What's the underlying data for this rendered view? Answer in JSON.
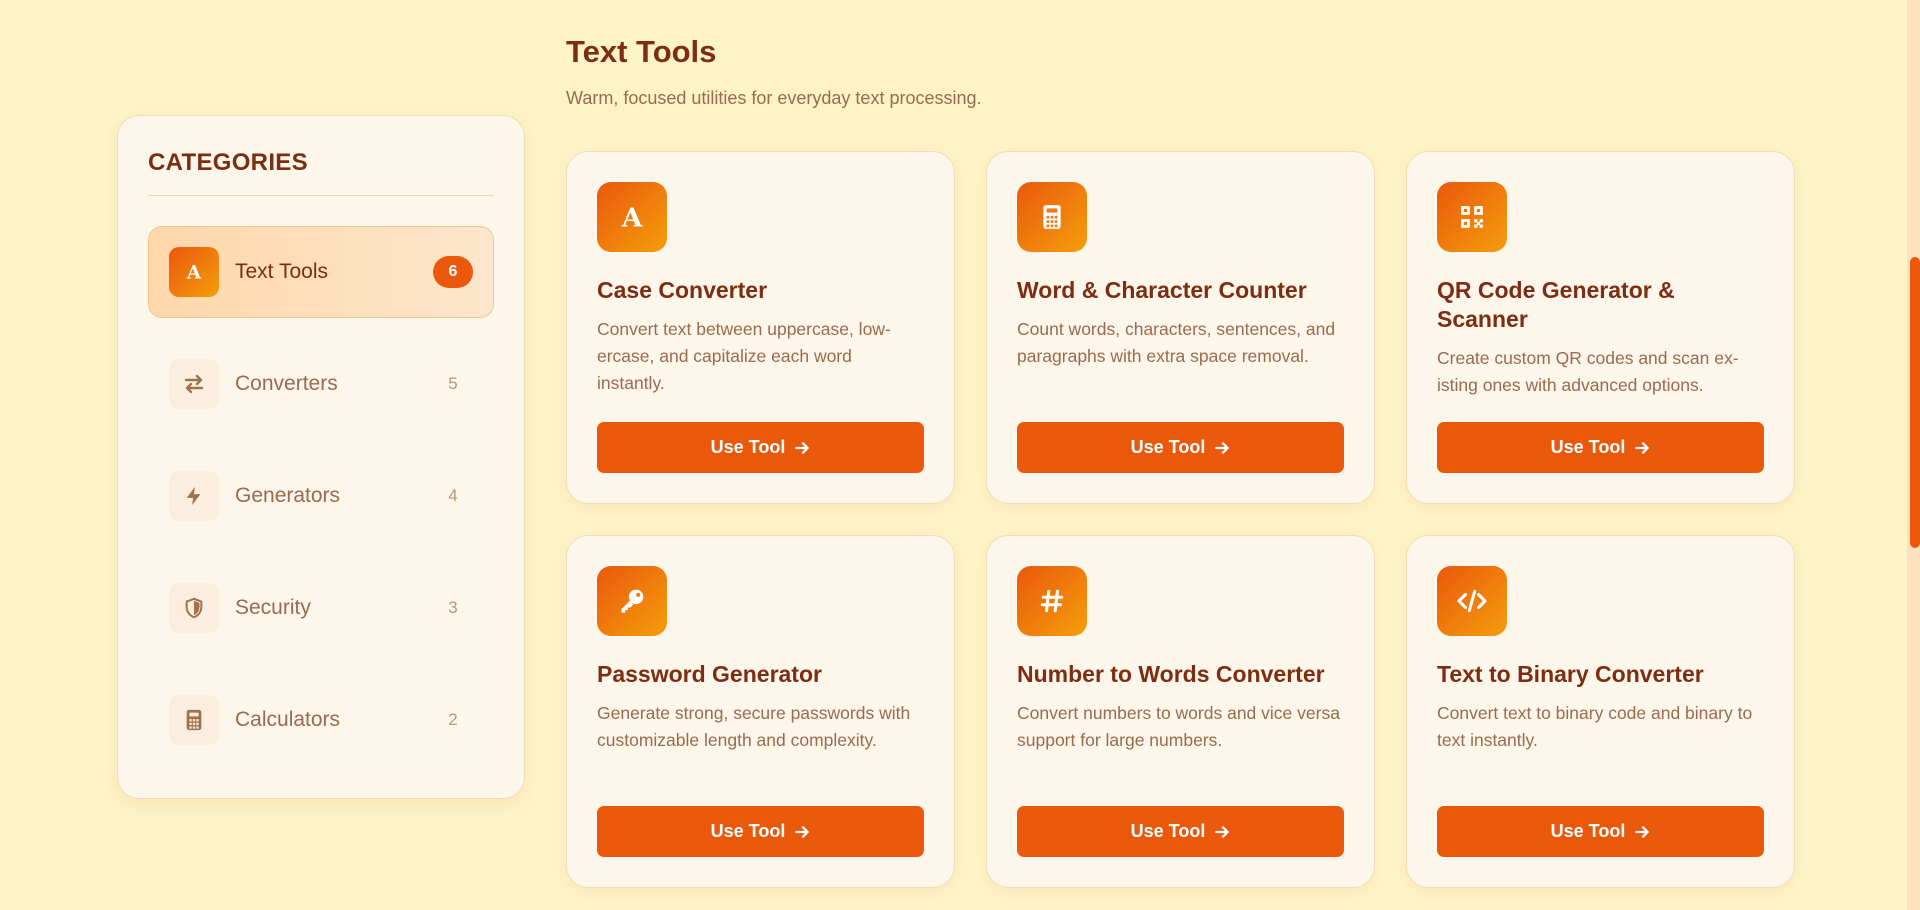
{
  "header": {
    "title": "Text Tools",
    "subtitle": "Warm, focused utilities for everyday text processing."
  },
  "sidebar": {
    "title": "CATEGORIES",
    "items": [
      {
        "label": "Text Tools",
        "count": "6",
        "icon": "letter-a-icon",
        "active": true
      },
      {
        "label": "Converters",
        "count": "5",
        "icon": "swap-arrows-icon",
        "active": false
      },
      {
        "label": "Generators",
        "count": "4",
        "icon": "lightning-bolt-icon",
        "active": false
      },
      {
        "label": "Security",
        "count": "3",
        "icon": "shield-icon",
        "active": false
      },
      {
        "label": "Calculators",
        "count": "2",
        "icon": "calculator-icon",
        "active": false
      }
    ]
  },
  "tools": [
    {
      "title": "Case Converter",
      "description": "Convert text between uppercase, low-ercase, and capitalize each word instantly.",
      "icon": "letter-a-icon",
      "button": "Use Tool"
    },
    {
      "title": "Word & Character Counter",
      "description": "Count words, characters, sentences, and paragraphs with extra space removal.",
      "icon": "calculator-icon",
      "button": "Use Tool"
    },
    {
      "title": "QR Code Generator & Scanner",
      "description": "Create custom QR codes and scan ex-isting ones with advanced options.",
      "icon": "qr-code-icon",
      "button": "Use Tool"
    },
    {
      "title": "Password Generator",
      "description": "Generate strong, secure passwords with customizable length and complexity.",
      "icon": "key-icon",
      "button": "Use Tool"
    },
    {
      "title": "Number to Words Converter",
      "description": "Convert numbers to words and vice versa support for large numbers.",
      "icon": "hash-icon",
      "button": "Use Tool"
    },
    {
      "title": "Text to Binary Converter",
      "description": "Convert text to binary code and binary to text instantly.",
      "icon": "code-icon",
      "button": "Use Tool"
    }
  ],
  "colors": {
    "background": "#fef3c7",
    "accent": "#ea580c",
    "accent_light": "#f59e0b",
    "heading": "#7c2d12",
    "muted": "#9a6b4e"
  }
}
